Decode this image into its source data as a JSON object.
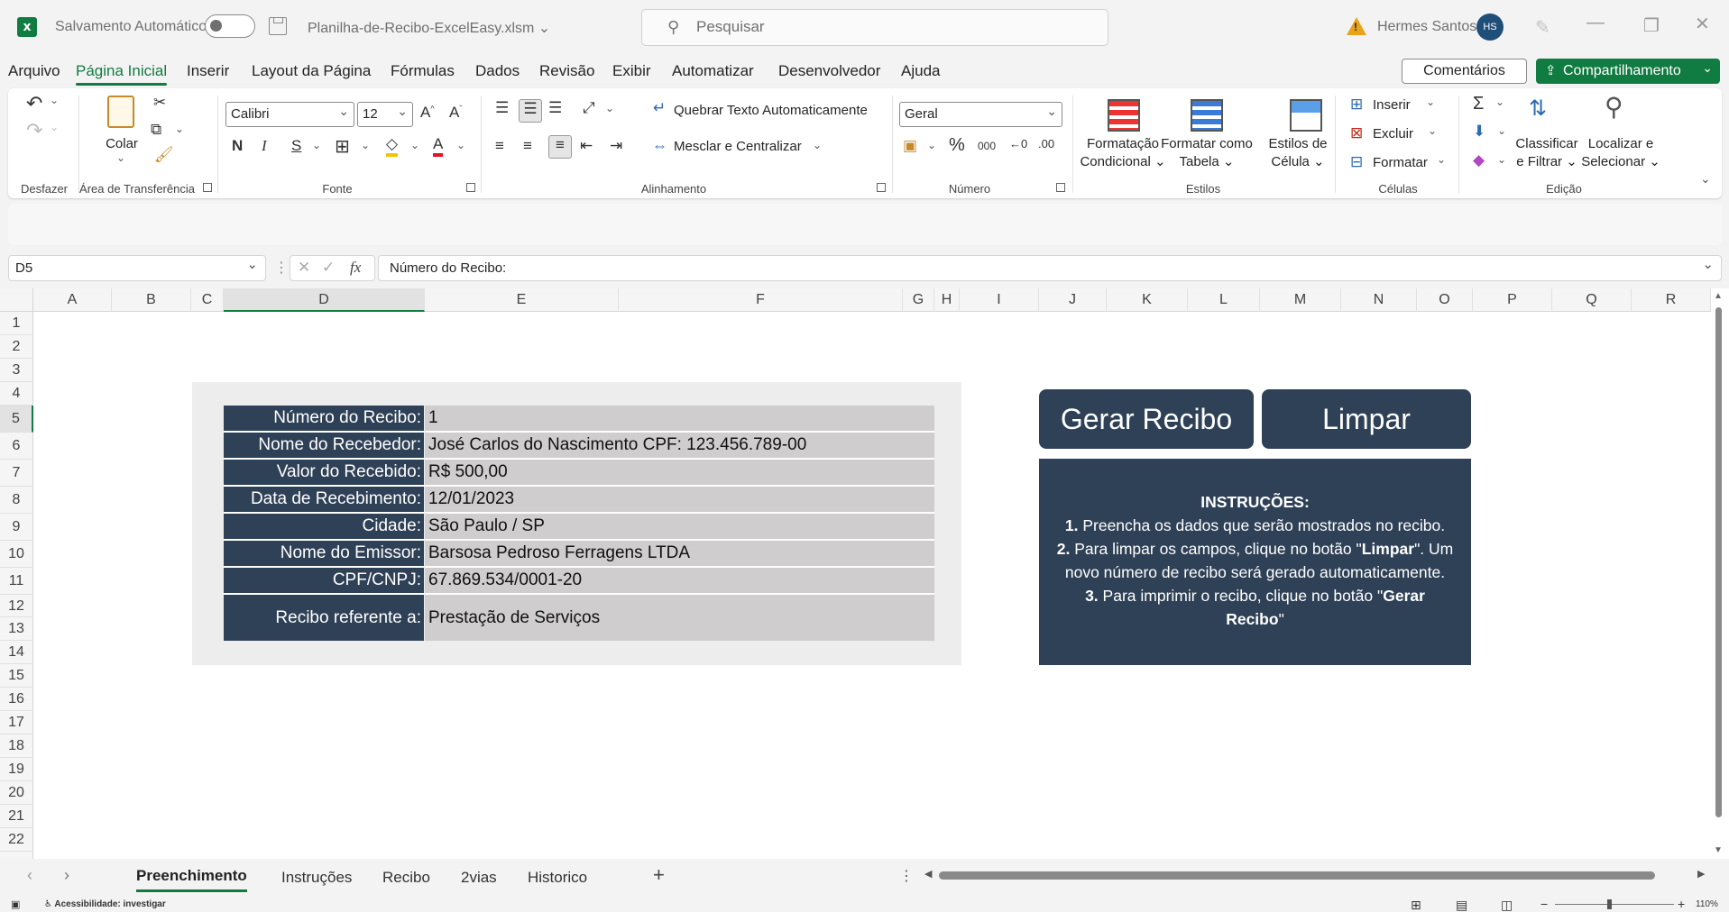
{
  "titlebar": {
    "autosave_label": "Salvamento Automático",
    "filename": "Planilha-de-Recibo-ExcelEasy.xlsm ⌄",
    "search_placeholder": "Pesquisar",
    "user_name": "Hermes Santos",
    "user_initials": "HS"
  },
  "menu": {
    "tabs": [
      "Arquivo",
      "Página Inicial",
      "Inserir",
      "Layout da Página",
      "Fórmulas",
      "Dados",
      "Revisão",
      "Exibir",
      "Automatizar",
      "Desenvolvedor",
      "Ajuda"
    ],
    "active": "Página Inicial",
    "comments": "Comentários",
    "share": "Compartilhamento"
  },
  "ribbon": {
    "groups": {
      "undo": "Desfazer",
      "clipboard": "Área de Transferência",
      "font": "Fonte",
      "alignment": "Alinhamento",
      "number": "Número",
      "styles": "Estilos",
      "cells": "Células",
      "editing": "Edição"
    },
    "paste_label": "Colar",
    "font_name": "Calibri",
    "font_size": "12",
    "bold": "N",
    "italic": "I",
    "underline": "S",
    "wrap_text": "Quebrar Texto Automaticamente",
    "merge_center": "Mesclar e Centralizar",
    "number_format": "Geral",
    "cond_format": "Formatação\nCondicional ⌄",
    "cond_format_l1": "Formatação",
    "cond_format_l2": "Condicional ⌄",
    "table_l1": "Formatar como",
    "table_l2": "Tabela ⌄",
    "cellstyle_l1": "Estilos de",
    "cellstyle_l2": "Célula ⌄",
    "insert": "Inserir",
    "delete": "Excluir",
    "format": "Formatar",
    "sort_l1": "Classificar",
    "sort_l2": "e Filtrar ⌄",
    "find_l1": "Localizar e",
    "find_l2": "Selecionar ⌄"
  },
  "formula_bar": {
    "cell_ref": "D5",
    "content": "Número do Recibo:"
  },
  "columns": [
    "A",
    "B",
    "C",
    "D",
    "E",
    "F",
    "G",
    "H",
    "I",
    "J",
    "K",
    "L",
    "M",
    "N",
    "O",
    "P",
    "Q",
    "R"
  ],
  "rows": [
    "1",
    "2",
    "3",
    "4",
    "5",
    "6",
    "7",
    "8",
    "9",
    "10",
    "11",
    "12",
    "13",
    "14",
    "15",
    "16",
    "17",
    "18",
    "19",
    "20",
    "21",
    "22"
  ],
  "form": {
    "fields": [
      {
        "label": "Número do Recibo:",
        "value": "1"
      },
      {
        "label": "Nome do Recebedor:",
        "value": "José Carlos do Nascimento CPF: 123.456.789-00"
      },
      {
        "label": "Valor do Recebido:",
        "value": "R$ 500,00"
      },
      {
        "label": "Data de Recebimento:",
        "value": "12/01/2023"
      },
      {
        "label": "Cidade:",
        "value": "São Paulo / SP"
      },
      {
        "label": "Nome do Emissor:",
        "value": "Barsosa Pedroso Ferragens LTDA"
      },
      {
        "label": "CPF/CNPJ:",
        "value": "67.869.534/0001-20"
      },
      {
        "label": "Recibo referente a:",
        "value": "Prestação de Serviços"
      }
    ]
  },
  "buttons": {
    "generate": "Gerar Recibo",
    "clear": "Limpar"
  },
  "instructions": {
    "title": "INSTRUÇÕES:",
    "s1_num": "1.",
    "s1_text": " Preencha os dados que serão mostrados no recibo.",
    "s2_num": "2.",
    "s2_text_a": " Para limpar os campos, clique no botão \"",
    "s2_bold": "Limpar",
    "s2_text_b": "\". Um",
    "s2_text_c": "novo número de recibo será gerado automaticamente.",
    "s3_num": "3.",
    "s3_text_a": " Para imprimir o recibo, clique no botão \"",
    "s3_bold_a": "Gerar",
    "s3_bold_b": "Recibo",
    "s3_text_b": "\""
  },
  "sheets": {
    "tabs": [
      "Preenchimento",
      "Instruções",
      "Recibo",
      "2vias",
      "Historico"
    ],
    "active": "Preenchimento"
  },
  "statusbar": {
    "accessibility": "Acessibilidade: investigar",
    "zoom": "110%"
  },
  "colors": {
    "excel_green": "#107c41",
    "form_navy": "#2f4157",
    "value_gray": "#cfcdce"
  }
}
